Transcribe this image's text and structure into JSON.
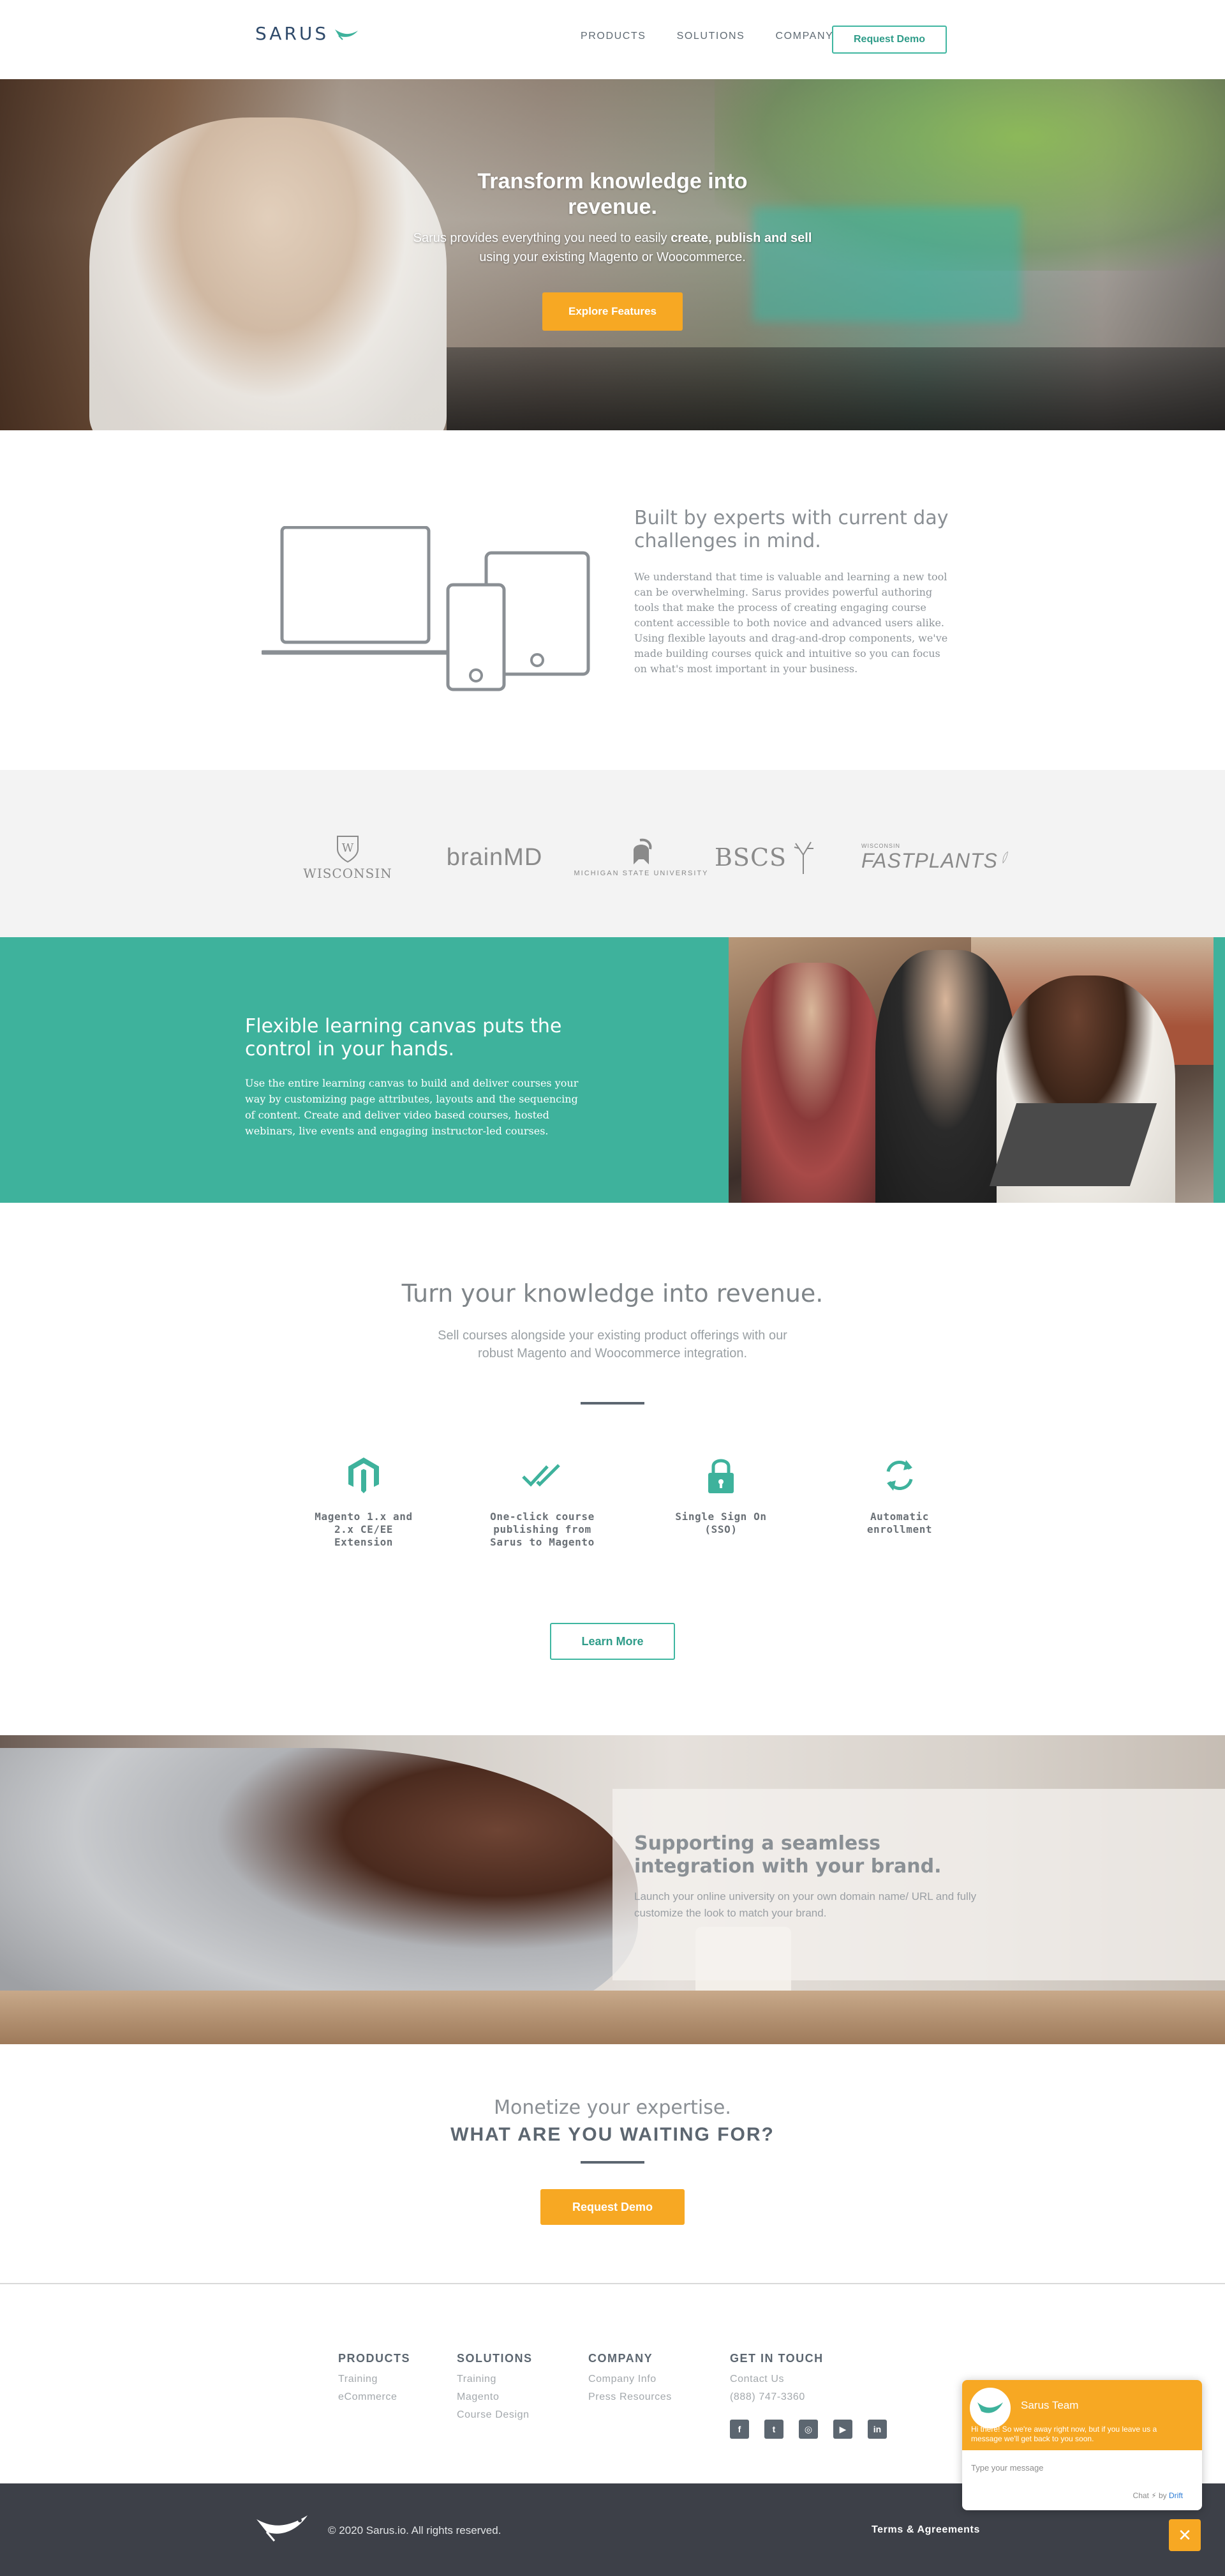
{
  "nav": {
    "logo_text": "SARUS",
    "links": [
      "PRODUCTS",
      "SOLUTIONS",
      "COMPANY"
    ],
    "cta_label": "Request Demo"
  },
  "hero": {
    "title": "Transform knowledge into revenue.",
    "sub_pre": "Sarus provides everything you need to easily ",
    "sub_bold1": "create, publish",
    "sub_mid": " ",
    "sub_bold2": "and sell",
    "sub_post": " using your existing Magento or Woocommerce.",
    "button_label": "Explore Features"
  },
  "experts": {
    "title": "Built by experts with current day challenges in mind.",
    "body": "We understand that time is valuable and learning a new tool can be overwhelming. Sarus provides powerful authoring tools that make the process of creating engaging course content accessible to both novice and advanced users alike. Using flexible layouts and drag-and-drop components, we've made building courses quick and intuitive so you can focus on what's most important in your business."
  },
  "partners": [
    {
      "name": "WISCONSIN",
      "icon": "university-crest-icon"
    },
    {
      "name": "brainMD",
      "icon": "brainmd-logo-icon"
    },
    {
      "name": "MICHIGAN STATE UNIVERSITY",
      "icon": "spartan-helmet-icon"
    },
    {
      "name": "BSCS",
      "icon": "deer-antler-icon"
    },
    {
      "name": "FASTPLANTS",
      "icon": "leaf-icon",
      "prefix": "WISCONSIN"
    }
  ],
  "flexible": {
    "title": "Flexible learning canvas puts the control in your hands.",
    "body": "Use the entire learning canvas to build and deliver courses your way by customizing page attributes, layouts and the sequencing of content. Create and deliver video based courses, hosted webinars, live events and engaging instructor-led courses."
  },
  "revenue": {
    "title": "Turn your knowledge into revenue.",
    "subtitle": "Sell courses alongside your existing product offerings with our robust Magento and Woocommerce integration.",
    "features": [
      {
        "label": "Magento 1.x and 2.x CE/EE Extension",
        "icon": "magento-icon"
      },
      {
        "label": "One-click course publishing from Sarus to Magento",
        "icon": "double-check-icon"
      },
      {
        "label": "Single Sign On (SSO)",
        "icon": "lock-icon"
      },
      {
        "label": "Automatic enrollment",
        "icon": "refresh-icon"
      }
    ],
    "button_label": "Learn More"
  },
  "support": {
    "title": "Supporting a seamless integration with your brand.",
    "body": "Launch your online university on your own domain name/ URL and fully customize the look to match your brand."
  },
  "cta": {
    "line1": "Monetize your expertise.",
    "line2": "WHAT ARE YOU WAITING FOR?",
    "button_label": "Request Demo"
  },
  "footer": {
    "columns": [
      {
        "heading": "PRODUCTS",
        "items": [
          "Training",
          "eCommerce"
        ]
      },
      {
        "heading": "SOLUTIONS",
        "items": [
          "Training",
          "Magento",
          "Course Design"
        ]
      },
      {
        "heading": "COMPANY",
        "items": [
          "Company Info",
          "Press Resources"
        ]
      },
      {
        "heading": "GET IN TOUCH",
        "items": [
          "Contact Us",
          "(888) 747-3360"
        ]
      }
    ],
    "social": [
      {
        "icon": "facebook-icon",
        "glyph": "f"
      },
      {
        "icon": "twitter-icon",
        "glyph": "t"
      },
      {
        "icon": "instagram-icon",
        "glyph": "◎"
      },
      {
        "icon": "youtube-icon",
        "glyph": "▶"
      },
      {
        "icon": "linkedin-icon",
        "glyph": "in"
      }
    ],
    "copyright": "© 2020 Sarus.io. All rights reserved.",
    "terms": "Terms & Agreements"
  },
  "chat": {
    "team": "Sarus Team",
    "message": "Hi there! So we're away right now, but if you leave us a message we'll get back to you soon.",
    "input_placeholder": "Type your message",
    "powered_pre": "Chat ⚡ by ",
    "powered_brand": "Drift"
  },
  "colors": {
    "teal": "#3eb29c",
    "orange": "#f7a823",
    "dark": "#3d4048",
    "text_gray": "#8a8f94"
  }
}
